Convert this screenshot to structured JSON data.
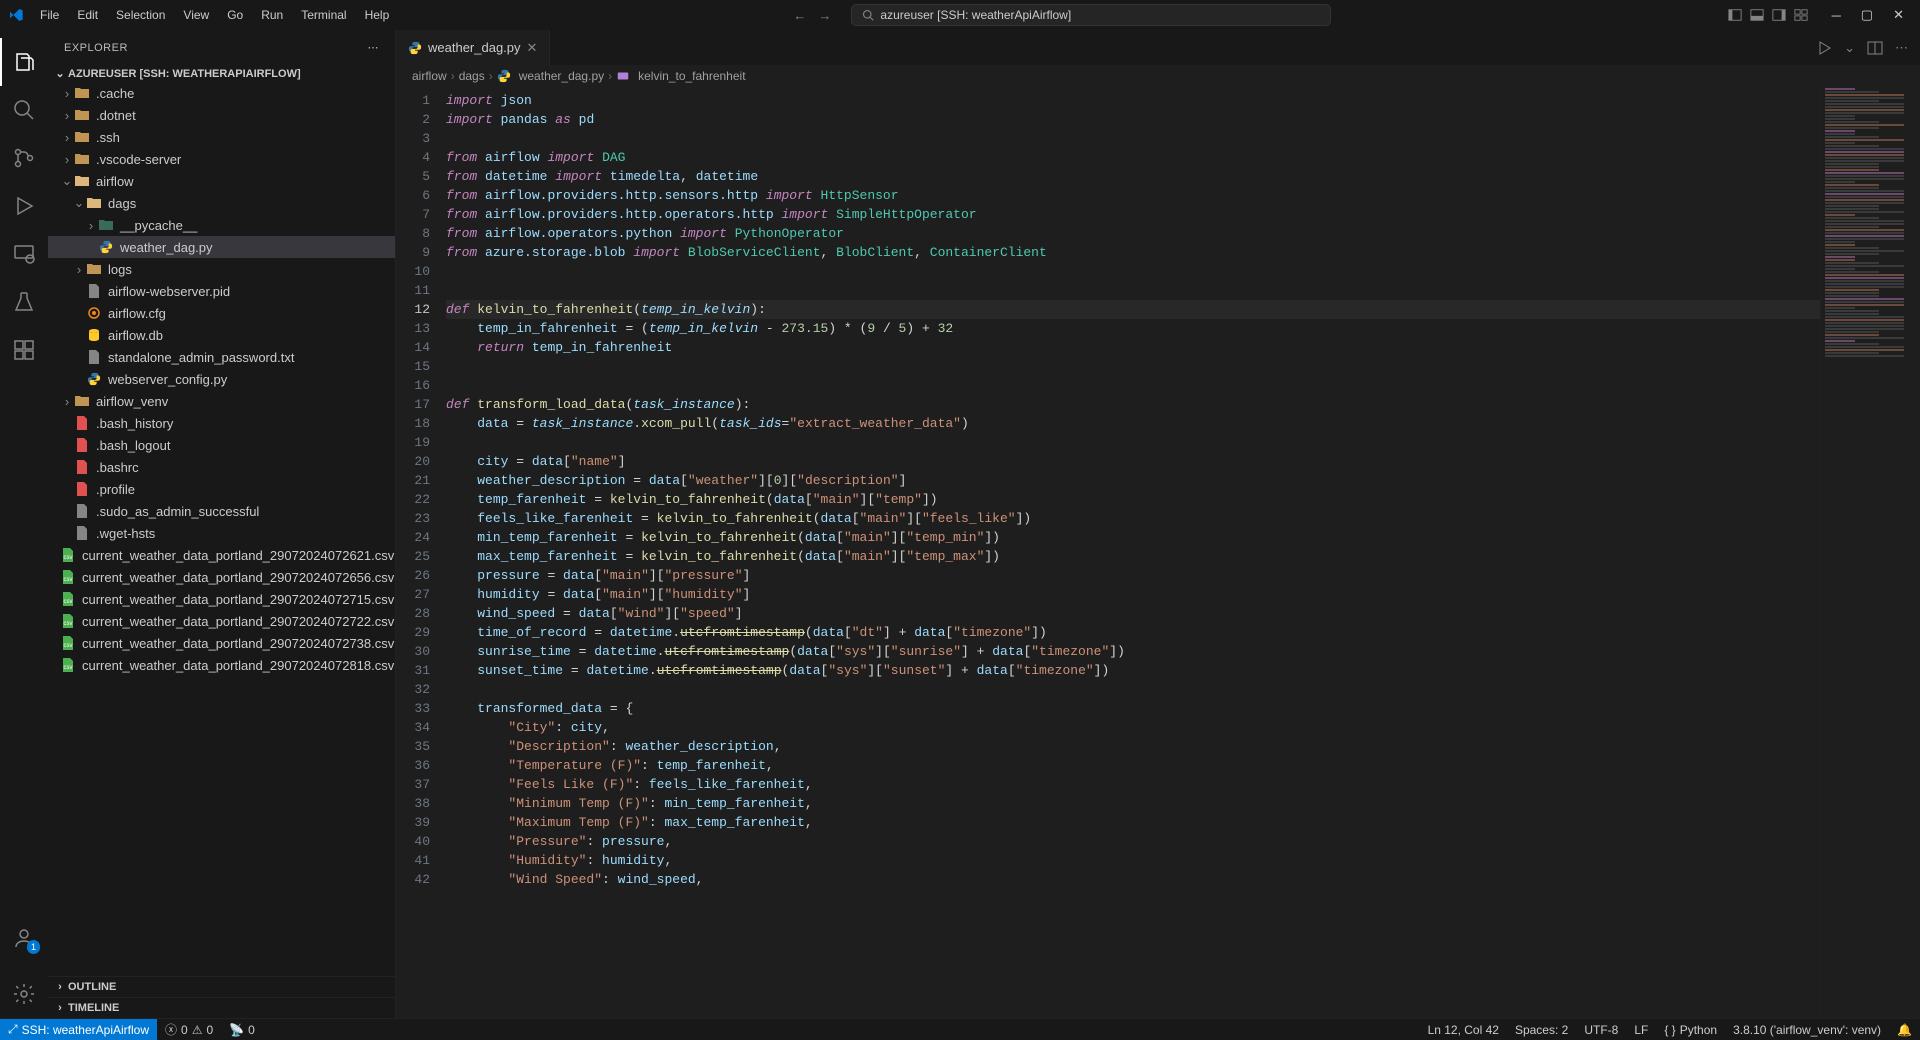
{
  "titlebar": {
    "menus": [
      "File",
      "Edit",
      "Selection",
      "View",
      "Go",
      "Run",
      "Terminal",
      "Help"
    ],
    "search": "azureuser [SSH: weatherApiAirflow]"
  },
  "sidebar": {
    "title": "EXPLORER",
    "workspace": "AZUREUSER [SSH: WEATHERAPIAIRFLOW]",
    "tree": [
      {
        "depth": 0,
        "type": "folder",
        "name": ".cache",
        "expandable": true,
        "open": false,
        "color": "#c09553"
      },
      {
        "depth": 0,
        "type": "folder",
        "name": ".dotnet",
        "expandable": true,
        "open": false,
        "color": "#c09553"
      },
      {
        "depth": 0,
        "type": "folder",
        "name": ".ssh",
        "expandable": true,
        "open": false,
        "color": "#c09553"
      },
      {
        "depth": 0,
        "type": "folder",
        "name": ".vscode-server",
        "expandable": true,
        "open": false,
        "color": "#c09553"
      },
      {
        "depth": 0,
        "type": "folder",
        "name": "airflow",
        "expandable": true,
        "open": true,
        "color": "#dcb67a"
      },
      {
        "depth": 1,
        "type": "folder",
        "name": "dags",
        "expandable": true,
        "open": true,
        "color": "#dcb67a"
      },
      {
        "depth": 2,
        "type": "folder",
        "name": "__pycache__",
        "expandable": true,
        "open": false,
        "color": "#3a6a5a"
      },
      {
        "depth": 2,
        "type": "python",
        "name": "weather_dag.py",
        "active": true
      },
      {
        "depth": 1,
        "type": "folder",
        "name": "logs",
        "expandable": true,
        "open": false,
        "color": "#c09553"
      },
      {
        "depth": 1,
        "type": "file",
        "name": "airflow-webserver.pid"
      },
      {
        "depth": 1,
        "type": "cfg",
        "name": "airflow.cfg"
      },
      {
        "depth": 1,
        "type": "db",
        "name": "airflow.db"
      },
      {
        "depth": 1,
        "type": "file",
        "name": "standalone_admin_password.txt"
      },
      {
        "depth": 1,
        "type": "python",
        "name": "webserver_config.py"
      },
      {
        "depth": 0,
        "type": "folder",
        "name": "airflow_venv",
        "expandable": true,
        "open": false,
        "color": "#c09553"
      },
      {
        "depth": 0,
        "type": "file",
        "name": ".bash_history",
        "color": "#e05252"
      },
      {
        "depth": 0,
        "type": "file",
        "name": ".bash_logout",
        "color": "#e05252"
      },
      {
        "depth": 0,
        "type": "file",
        "name": ".bashrc",
        "color": "#e05252"
      },
      {
        "depth": 0,
        "type": "file",
        "name": ".profile",
        "color": "#e05252"
      },
      {
        "depth": 0,
        "type": "file",
        "name": ".sudo_as_admin_successful"
      },
      {
        "depth": 0,
        "type": "file",
        "name": ".wget-hsts"
      },
      {
        "depth": 0,
        "type": "csv",
        "name": "current_weather_data_portland_29072024072621.csv"
      },
      {
        "depth": 0,
        "type": "csv",
        "name": "current_weather_data_portland_29072024072656.csv"
      },
      {
        "depth": 0,
        "type": "csv",
        "name": "current_weather_data_portland_29072024072715.csv"
      },
      {
        "depth": 0,
        "type": "csv",
        "name": "current_weather_data_portland_29072024072722.csv"
      },
      {
        "depth": 0,
        "type": "csv",
        "name": "current_weather_data_portland_29072024072738.csv"
      },
      {
        "depth": 0,
        "type": "csv",
        "name": "current_weather_data_portland_29072024072818.csv"
      }
    ],
    "outline": "OUTLINE",
    "timeline": "TIMELINE"
  },
  "tab": {
    "filename": "weather_dag.py"
  },
  "breadcrumb": [
    "airflow",
    "dags",
    "weather_dag.py",
    "kelvin_to_fahrenheit"
  ],
  "code_lines": [
    {
      "n": 1,
      "html": "<span class='kw'>import</span> <span class='var'>json</span>"
    },
    {
      "n": 2,
      "html": "<span class='kw'>import</span> <span class='var'>pandas</span> <span class='kw'>as</span> <span class='var'>pd</span>"
    },
    {
      "n": 3,
      "html": ""
    },
    {
      "n": 4,
      "html": "<span class='kw'>from</span> <span class='var'>airflow</span> <span class='kw'>import</span> <span class='cls'>DAG</span>"
    },
    {
      "n": 5,
      "html": "<span class='kw'>from</span> <span class='var'>datetime</span> <span class='kw'>import</span> <span class='var'>timedelta</span>, <span class='var'>datetime</span>"
    },
    {
      "n": 6,
      "html": "<span class='kw'>from</span> <span class='var'>airflow.providers.http.sensors.http</span> <span class='kw'>import</span> <span class='cls'>HttpSensor</span>"
    },
    {
      "n": 7,
      "html": "<span class='kw'>from</span> <span class='var'>airflow.providers.http.operators.http</span> <span class='kw'>import</span> <span class='cls'>SimpleHttpOperator</span>"
    },
    {
      "n": 8,
      "html": "<span class='kw'>from</span> <span class='var'>airflow.operators.python</span> <span class='kw'>import</span> <span class='cls'>PythonOperator</span>"
    },
    {
      "n": 9,
      "html": "<span class='kw'>from</span> <span class='var'>azure.storage.blob</span> <span class='kw'>import</span> <span class='cls'>BlobServiceClient</span>, <span class='cls'>BlobClient</span>, <span class='cls'>ContainerClient</span>"
    },
    {
      "n": 10,
      "html": ""
    },
    {
      "n": 11,
      "html": ""
    },
    {
      "n": 12,
      "hl": true,
      "html": "<span class='kw'>def</span> <span class='fn'>kelvin_to_fahrenheit</span>(<span class='param'>temp_in_kelvin</span>):"
    },
    {
      "n": 13,
      "html": "    <span class='var'>temp_in_fahrenheit</span> = (<span class='param'>temp_in_kelvin</span> - <span class='num'>273.15</span>) * (<span class='num'>9</span> / <span class='num'>5</span>) + <span class='num'>32</span>"
    },
    {
      "n": 14,
      "html": "    <span class='kw'>return</span> <span class='var'>temp_in_fahrenheit</span>"
    },
    {
      "n": 15,
      "html": ""
    },
    {
      "n": 16,
      "html": ""
    },
    {
      "n": 17,
      "html": "<span class='kw'>def</span> <span class='fn'>transform_load_data</span>(<span class='param'>task_instance</span>):"
    },
    {
      "n": 18,
      "html": "    <span class='var'>data</span> = <span class='param'>task_instance</span>.<span class='fn'>xcom_pull</span>(<span class='param'>task_ids</span>=<span class='str'>\"extract_weather_data\"</span>)"
    },
    {
      "n": 19,
      "html": ""
    },
    {
      "n": 20,
      "html": "    <span class='var'>city</span> = <span class='var'>data</span>[<span class='str'>\"name\"</span>]"
    },
    {
      "n": 21,
      "html": "    <span class='var'>weather_description</span> = <span class='var'>data</span>[<span class='str'>\"weather\"</span>][<span class='num'>0</span>][<span class='str'>\"description\"</span>]"
    },
    {
      "n": 22,
      "html": "    <span class='var'>temp_farenheit</span> = <span class='fn'>kelvin_to_fahrenheit</span>(<span class='var'>data</span>[<span class='str'>\"main\"</span>][<span class='str'>\"temp\"</span>])"
    },
    {
      "n": 23,
      "html": "    <span class='var'>feels_like_farenheit</span> = <span class='fn'>kelvin_to_fahrenheit</span>(<span class='var'>data</span>[<span class='str'>\"main\"</span>][<span class='str'>\"feels_like\"</span>])"
    },
    {
      "n": 24,
      "html": "    <span class='var'>min_temp_farenheit</span> = <span class='fn'>kelvin_to_fahrenheit</span>(<span class='var'>data</span>[<span class='str'>\"main\"</span>][<span class='str'>\"temp_min\"</span>])"
    },
    {
      "n": 25,
      "html": "    <span class='var'>max_temp_farenheit</span> = <span class='fn'>kelvin_to_fahrenheit</span>(<span class='var'>data</span>[<span class='str'>\"main\"</span>][<span class='str'>\"temp_max\"</span>])"
    },
    {
      "n": 26,
      "html": "    <span class='var'>pressure</span> = <span class='var'>data</span>[<span class='str'>\"main\"</span>][<span class='str'>\"pressure\"</span>]"
    },
    {
      "n": 27,
      "html": "    <span class='var'>humidity</span> = <span class='var'>data</span>[<span class='str'>\"main\"</span>][<span class='str'>\"humidity\"</span>]"
    },
    {
      "n": 28,
      "html": "    <span class='var'>wind_speed</span> = <span class='var'>data</span>[<span class='str'>\"wind\"</span>][<span class='str'>\"speed\"</span>]"
    },
    {
      "n": 29,
      "html": "    <span class='var'>time_of_record</span> = <span class='var'>datetime</span>.<span class='fn deprecated'>utcfromtimestamp</span>(<span class='var'>data</span>[<span class='str'>\"dt\"</span>] + <span class='var'>data</span>[<span class='str'>\"timezone\"</span>])"
    },
    {
      "n": 30,
      "html": "    <span class='var'>sunrise_time</span> = <span class='var'>datetime</span>.<span class='fn deprecated'>utcfromtimestamp</span>(<span class='var'>data</span>[<span class='str'>\"sys\"</span>][<span class='str'>\"sunrise\"</span>] + <span class='var'>data</span>[<span class='str'>\"timezone\"</span>])"
    },
    {
      "n": 31,
      "html": "    <span class='var'>sunset_time</span> = <span class='var'>datetime</span>.<span class='fn deprecated'>utcfromtimestamp</span>(<span class='var'>data</span>[<span class='str'>\"sys\"</span>][<span class='str'>\"sunset\"</span>] + <span class='var'>data</span>[<span class='str'>\"timezone\"</span>])"
    },
    {
      "n": 32,
      "html": ""
    },
    {
      "n": 33,
      "html": "    <span class='var'>transformed_data</span> = {"
    },
    {
      "n": 34,
      "html": "        <span class='str'>\"City\"</span>: <span class='var'>city</span>,"
    },
    {
      "n": 35,
      "html": "        <span class='str'>\"Description\"</span>: <span class='var'>weather_description</span>,"
    },
    {
      "n": 36,
      "html": "        <span class='str'>\"Temperature (F)\"</span>: <span class='var'>temp_farenheit</span>,"
    },
    {
      "n": 37,
      "html": "        <span class='str'>\"Feels Like (F)\"</span>: <span class='var'>feels_like_farenheit</span>,"
    },
    {
      "n": 38,
      "html": "        <span class='str'>\"Minimum Temp (F)\"</span>: <span class='var'>min_temp_farenheit</span>,"
    },
    {
      "n": 39,
      "html": "        <span class='str'>\"Maximum Temp (F)\"</span>: <span class='var'>max_temp_farenheit</span>,"
    },
    {
      "n": 40,
      "html": "        <span class='str'>\"Pressure\"</span>: <span class='var'>pressure</span>,"
    },
    {
      "n": 41,
      "html": "        <span class='str'>\"Humidity\"</span>: <span class='var'>humidity</span>,"
    },
    {
      "n": 42,
      "html": "        <span class='str'>\"Wind Speed\"</span>: <span class='var'>wind_speed</span>,"
    }
  ],
  "statusbar": {
    "remote": "SSH: weatherApiAirflow",
    "errors": "0",
    "warnings": "0",
    "ports": "0",
    "position": "Ln 12, Col 42",
    "spaces": "Spaces: 2",
    "encoding": "UTF-8",
    "eol": "LF",
    "language": "Python",
    "interpreter": "3.8.10 ('airflow_venv': venv)"
  }
}
